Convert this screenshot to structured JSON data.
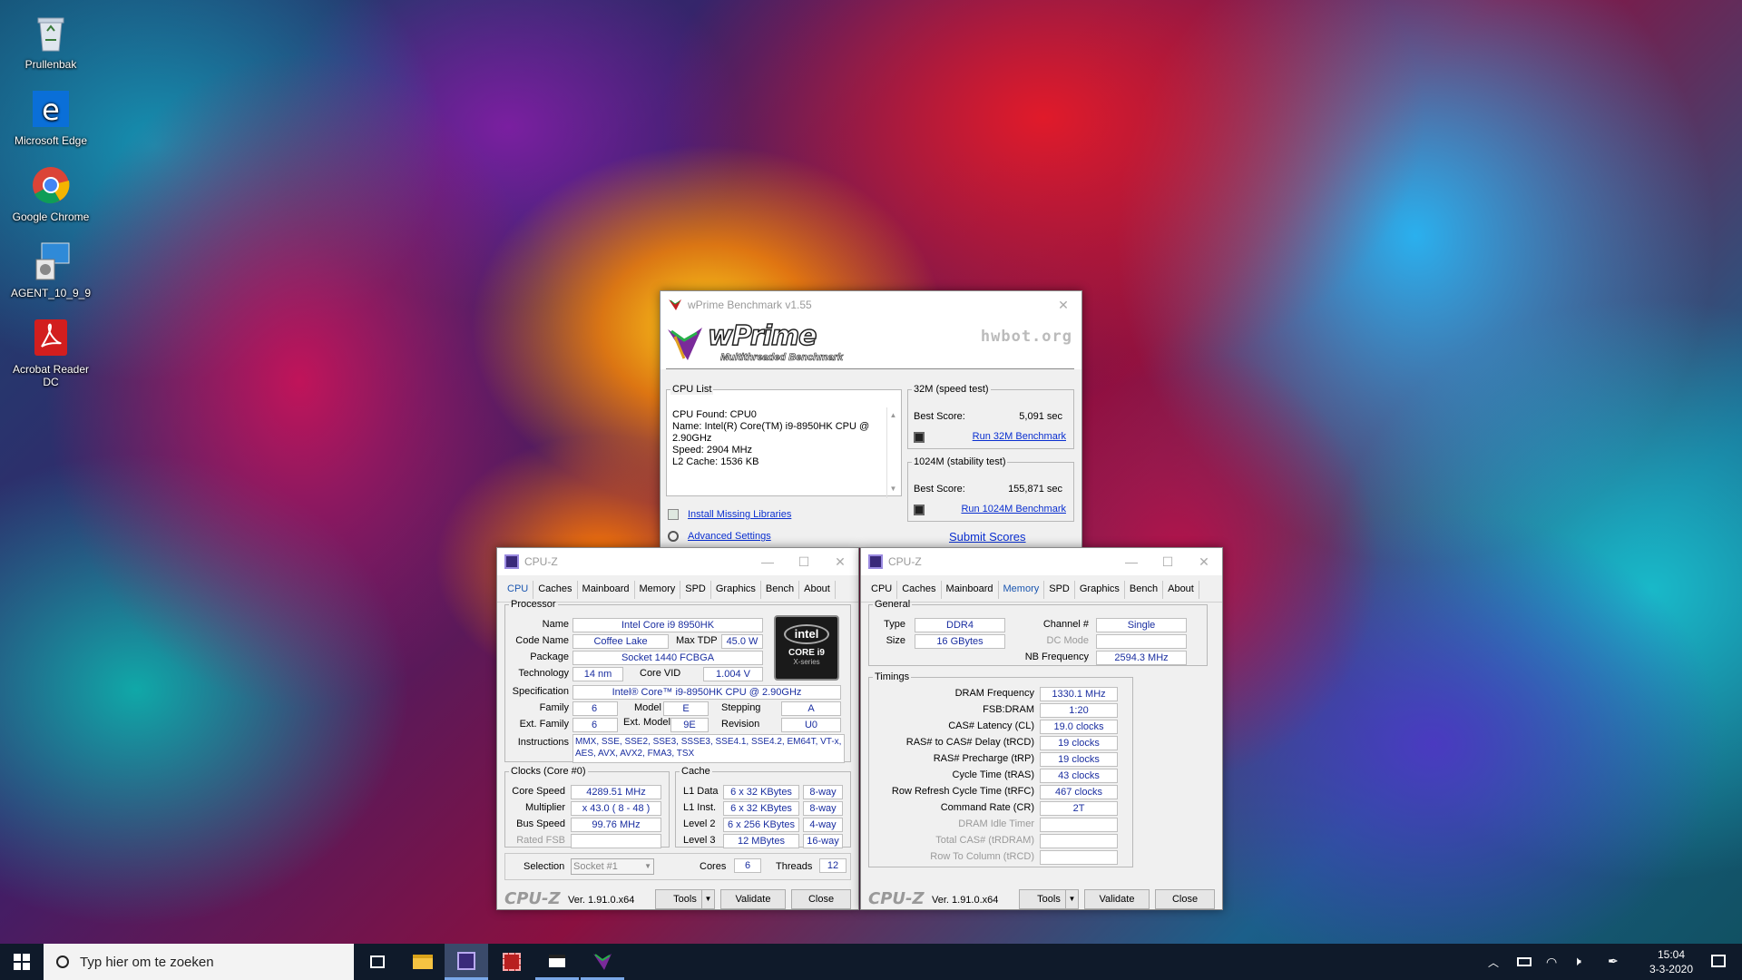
{
  "desktop": {
    "icons": [
      {
        "label": "Prullenbak",
        "icon": "recycle-bin-icon"
      },
      {
        "label": "Microsoft Edge",
        "icon": "edge-icon"
      },
      {
        "label": "Google Chrome",
        "icon": "chrome-icon"
      },
      {
        "label": "AGENT_10_9_9",
        "icon": "agent-icon"
      },
      {
        "label": "Acrobat Reader DC",
        "icon": "acrobat-icon"
      }
    ]
  },
  "wprime": {
    "title": "wPrime Benchmark v1.55",
    "logo": "wPrime",
    "logo_sub": "Multithreaded Benchmark",
    "hwbot": "hwbot.org",
    "cpu_list": {
      "legend": "CPU List",
      "lines": [
        "CPU Found: CPU0",
        "Name:   Intel(R) Core(TM) i9-8950HK CPU @",
        "2.90GHz",
        "Speed:   2904 MHz",
        "L2 Cache: 1536 KB"
      ]
    },
    "speed_test": {
      "legend": "32M (speed test)",
      "best_label": "Best Score:",
      "best_value": "5,091 sec",
      "run_link": "Run 32M Benchmark"
    },
    "stability_test": {
      "legend": "1024M (stability test)",
      "best_label": "Best Score:",
      "best_value": "155,871 sec",
      "run_link": "Run 1024M Benchmark"
    },
    "install_link": "Install Missing Libraries",
    "advanced_link": "Advanced Settings",
    "submit_link": "Submit Scores"
  },
  "cpuz_cpu": {
    "title": "CPU-Z",
    "tabs": [
      "CPU",
      "Caches",
      "Mainboard",
      "Memory",
      "SPD",
      "Graphics",
      "Bench",
      "About"
    ],
    "active_tab": "CPU",
    "processor": {
      "legend": "Processor",
      "name_label": "Name",
      "name": "Intel Core i9 8950HK",
      "codename_label": "Code Name",
      "codename": "Coffee Lake",
      "maxtdp_label": "Max TDP",
      "maxtdp": "45.0 W",
      "package_label": "Package",
      "package": "Socket 1440 FCBGA",
      "tech_label": "Technology",
      "tech": "14 nm",
      "corevid_label": "Core VID",
      "corevid": "1.004 V",
      "spec_label": "Specification",
      "spec": "Intel® Core™ i9-8950HK CPU @ 2.90GHz",
      "family_label": "Family",
      "family": "6",
      "model_label": "Model",
      "model": "E",
      "stepping_label": "Stepping",
      "stepping": "A",
      "extfamily_label": "Ext. Family",
      "extfamily": "6",
      "extmodel_label": "Ext. Model",
      "extmodel": "9E",
      "revision_label": "Revision",
      "revision": "U0",
      "instr_label": "Instructions",
      "instr1": "MMX, SSE, SSE2, SSE3, SSSE3, SSE4.1, SSE4.2, EM64T, VT-x,",
      "instr2": "AES, AVX, AVX2, FMA3, TSX",
      "badge_brand": "intel",
      "badge_model": "CORE i9",
      "badge_series": "X-series"
    },
    "clocks": {
      "legend": "Clocks (Core #0)",
      "corespeed_label": "Core Speed",
      "corespeed": "4289.51 MHz",
      "mult_label": "Multiplier",
      "mult": "x 43.0 ( 8 - 48 )",
      "bus_label": "Bus Speed",
      "bus": "99.76 MHz",
      "ratedfsb_label": "Rated FSB",
      "ratedfsb": ""
    },
    "cache": {
      "legend": "Cache",
      "l1d_label": "L1 Data",
      "l1d": "6 x 32 KBytes",
      "l1d_way": "8-way",
      "l1i_label": "L1 Inst.",
      "l1i": "6 x 32 KBytes",
      "l1i_way": "8-way",
      "l2_label": "Level 2",
      "l2": "6 x 256 KBytes",
      "l2_way": "4-way",
      "l3_label": "Level 3",
      "l3": "12 MBytes",
      "l3_way": "16-way"
    },
    "selection_label": "Selection",
    "selection": "Socket #1",
    "cores_label": "Cores",
    "cores": "6",
    "threads_label": "Threads",
    "threads": "12",
    "brand": "CPU-Z",
    "version": "Ver. 1.91.0.x64",
    "tools": "Tools",
    "validate": "Validate",
    "close": "Close"
  },
  "cpuz_mem": {
    "title": "CPU-Z",
    "tabs": [
      "CPU",
      "Caches",
      "Mainboard",
      "Memory",
      "SPD",
      "Graphics",
      "Bench",
      "About"
    ],
    "active_tab": "Memory",
    "general": {
      "legend": "General",
      "type_label": "Type",
      "type": "DDR4",
      "size_label": "Size",
      "size": "16 GBytes",
      "channel_label": "Channel #",
      "channel": "Single",
      "dcmode_label": "DC Mode",
      "dcmode": "",
      "nbfreq_label": "NB Frequency",
      "nbfreq": "2594.3 MHz"
    },
    "timings": {
      "legend": "Timings",
      "rows": [
        {
          "label": "DRAM Frequency",
          "value": "1330.1 MHz",
          "grey": false
        },
        {
          "label": "FSB:DRAM",
          "value": "1:20",
          "grey": false
        },
        {
          "label": "CAS# Latency (CL)",
          "value": "19.0 clocks",
          "grey": false
        },
        {
          "label": "RAS# to CAS# Delay (tRCD)",
          "value": "19 clocks",
          "grey": false
        },
        {
          "label": "RAS# Precharge (tRP)",
          "value": "19 clocks",
          "grey": false
        },
        {
          "label": "Cycle Time (tRAS)",
          "value": "43 clocks",
          "grey": false
        },
        {
          "label": "Row Refresh Cycle Time (tRFC)",
          "value": "467 clocks",
          "grey": false
        },
        {
          "label": "Command Rate (CR)",
          "value": "2T",
          "grey": false
        },
        {
          "label": "DRAM Idle Timer",
          "value": "",
          "grey": true
        },
        {
          "label": "Total CAS# (tRDRAM)",
          "value": "",
          "grey": true
        },
        {
          "label": "Row To Column (tRCD)",
          "value": "",
          "grey": true
        }
      ]
    },
    "brand": "CPU-Z",
    "version": "Ver. 1.91.0.x64",
    "tools": "Tools",
    "validate": "Validate",
    "close": "Close"
  },
  "taskbar": {
    "search_placeholder": "Typ hier om te zoeken",
    "time": "15:04",
    "date": "3-3-2020"
  }
}
